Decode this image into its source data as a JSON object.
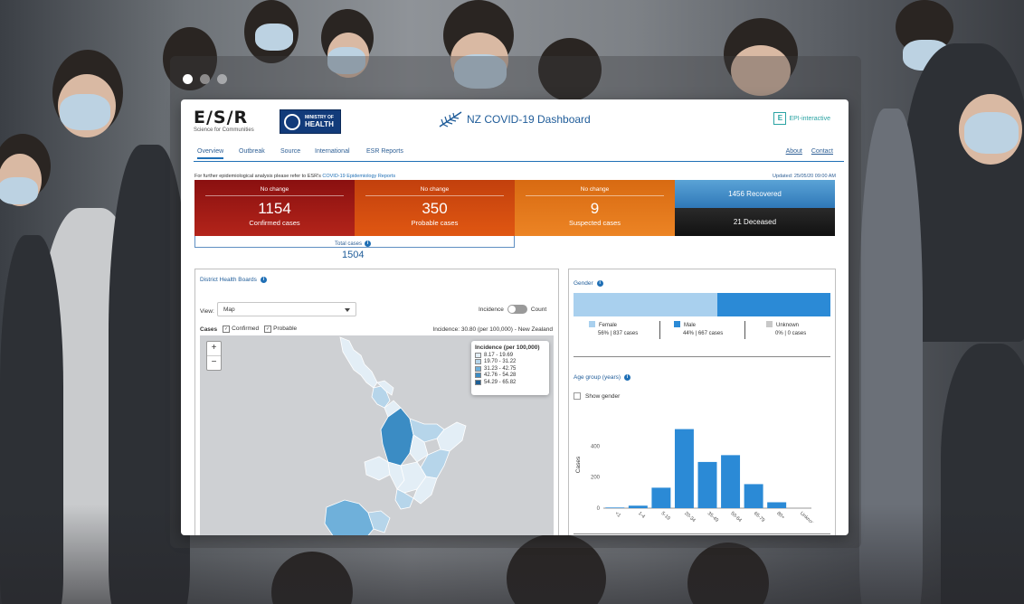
{
  "carousel": {
    "dots": [
      {
        "active": true
      },
      {
        "active": false
      },
      {
        "active": false
      }
    ]
  },
  "header": {
    "esr_logo": "E/S/R",
    "esr_tagline": "Science for Communities",
    "moh_line1": "MINISTRY OF",
    "moh_line2": "HEALTH",
    "title": "NZ  COVID-19  Dashboard",
    "epi_mark": "E",
    "epi_text": "EPI-interactive"
  },
  "nav": {
    "items": [
      "Overview",
      "Outbreak",
      "Source",
      "International",
      "ESR Reports"
    ],
    "active": "Overview",
    "about": "About",
    "contact": "Contact"
  },
  "notice": {
    "prefix": "For further epidemiological analysis please refer to ESR's",
    "link": "COVID-19 Epidemiology Reports",
    "updated": "Updated: 25/05/20 09:00 AM"
  },
  "stats": {
    "confirmed": {
      "change": "No change",
      "value": "1154",
      "label": "Confirmed cases",
      "color": "#9e1a14"
    },
    "probable": {
      "change": "No change",
      "value": "350",
      "label": "Probable cases",
      "color": "#d44c10"
    },
    "suspected": {
      "change": "No change",
      "value": "9",
      "label": "Suspected cases",
      "color": "#e5781c"
    },
    "recovered": "1456 Recovered",
    "deceased": "21 Deceased",
    "total_label": "Total cases",
    "total_value": "1504"
  },
  "dhb": {
    "title": "District Health Boards",
    "view_label": "View:",
    "view_value": "Map",
    "toggle_left": "Incidence",
    "toggle_right": "Count",
    "cases_label": "Cases",
    "confirmed": "Confirmed",
    "probable": "Probable",
    "incidence_nz": "Incidence: 30.80 (per 100,000) - New Zealand",
    "zoom_in": "+",
    "zoom_out": "−",
    "legend_title": "Incidence (per 100,000)",
    "legend": [
      {
        "label": "8.17 - 19.69",
        "color": "#e3eef6"
      },
      {
        "label": "19.70 - 31.22",
        "color": "#b6d5ea"
      },
      {
        "label": "31.23 - 42.75",
        "color": "#6fb0da"
      },
      {
        "label": "42.76 - 54.28",
        "color": "#3b8cc4"
      },
      {
        "label": "54.29 - 65.82",
        "color": "#1d5f96"
      }
    ]
  },
  "gender": {
    "title": "Gender",
    "segments": [
      {
        "name": "Female",
        "value": "56% | 837 cases",
        "share": 0.56,
        "color": "#a9d0ee"
      },
      {
        "name": "Male",
        "value": "44% | 667 cases",
        "share": 0.44,
        "color": "#2b8ad6"
      },
      {
        "name": "Unknown",
        "value": "0% | 0 cases",
        "share": 0.0,
        "color": "#c8c8c8"
      }
    ]
  },
  "age": {
    "title": "Age group (years)",
    "show_gender": "Show gender"
  },
  "chart_data": {
    "type": "bar",
    "categories": [
      "<1",
      "1-4",
      "5-19",
      "20-34",
      "35-49",
      "50-64",
      "65-79",
      "80+",
      "Unknown"
    ],
    "values": [
      4,
      16,
      132,
      510,
      298,
      342,
      155,
      38,
      0
    ],
    "ylabel": "Cases",
    "yticks": [
      0,
      200,
      400
    ],
    "ylim": [
      0,
      560
    ],
    "grid": false,
    "color": "#2b8ad6"
  }
}
